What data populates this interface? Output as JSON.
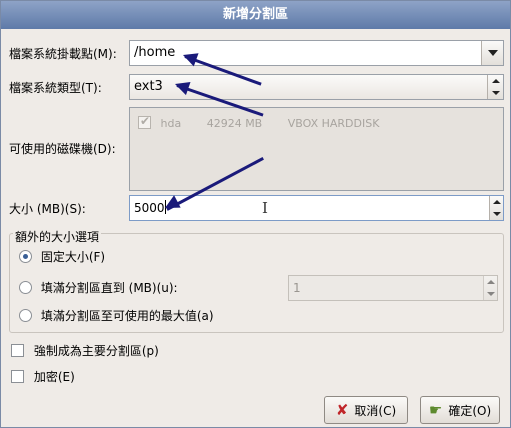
{
  "window": {
    "title": "新增分割區"
  },
  "mount_point": {
    "label": "檔案系統掛載點(M):",
    "value": "/home"
  },
  "fs_type": {
    "label": "檔案系統類型(T):",
    "value": "ext3"
  },
  "drives": {
    "label": "可使用的磁碟機(D):",
    "rows": [
      {
        "checked": true,
        "name": "hda",
        "size": "42924 MB",
        "model": "VBOX HARDDISK"
      }
    ]
  },
  "size": {
    "label": "大小 (MB)(S):",
    "value": "5000"
  },
  "size_options": {
    "title": "額外的大小選項",
    "fixed_label": "固定大小(F)",
    "fill_to_label": "填滿分割區直到 (MB)(u):",
    "fill_to_value": "1",
    "fill_max_label": "填滿分割區至可使用的最大值(a)",
    "selected": "fixed"
  },
  "force_primary": {
    "label": "強制成為主要分割區(p)",
    "checked": false
  },
  "encrypt": {
    "label": "加密(E)",
    "checked": false
  },
  "buttons": {
    "cancel": "取消(C)",
    "ok": "確定(O)"
  },
  "colors": {
    "title_bg": "#6f88b5",
    "annotation_arrow": "#1a1a7a",
    "cancel_icon": "#c0262a",
    "ok_icon": "#5d8a2e"
  }
}
